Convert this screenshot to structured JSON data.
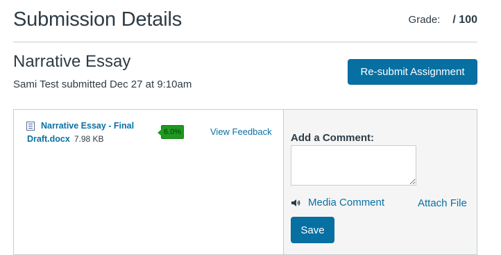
{
  "header": {
    "title": "Submission Details",
    "grade_label": "Grade:",
    "grade_value": "/ 100"
  },
  "assignment": {
    "title": "Narrative Essay",
    "submitted_text": "Sami Test submitted Dec 27 at 9:10am",
    "resubmit_label": "Re-submit Assignment"
  },
  "submission_file": {
    "name": "Narrative Essay - Final Draft.docx",
    "size": "7.98 KB",
    "icon": "document-icon",
    "similarity_score": "6.0%",
    "similarity_color": "#1f9a1f",
    "view_feedback_label": "View Feedback"
  },
  "comment": {
    "label": "Add a Comment:",
    "value": "",
    "media_comment_label": "Media Comment",
    "media_icon": "speaker-icon",
    "attach_file_label": "Attach File",
    "save_label": "Save"
  },
  "colors": {
    "accent": "#0770a3",
    "text": "#2d3b45",
    "comment_pane_bg": "#f5f5f5"
  }
}
